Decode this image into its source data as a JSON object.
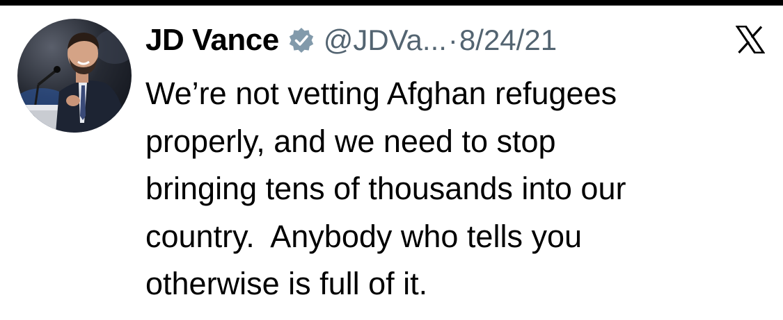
{
  "tweet": {
    "author_name": "JD Vance",
    "handle": "@JDVa...",
    "separator": "·",
    "date": "8/24/21",
    "verified_icon": "verified-badge-icon",
    "brand_icon": "x-logo-icon",
    "text_lines": [
      "We’re not vetting Afghan refugees",
      "properly, and we need to stop",
      "bringing tens of thousands into our",
      "country.  Anybody who tells you",
      "otherwise is full of it."
    ]
  },
  "colors": {
    "text": "#000000",
    "secondary_text": "#536471",
    "verified_badge": "#829aab"
  }
}
